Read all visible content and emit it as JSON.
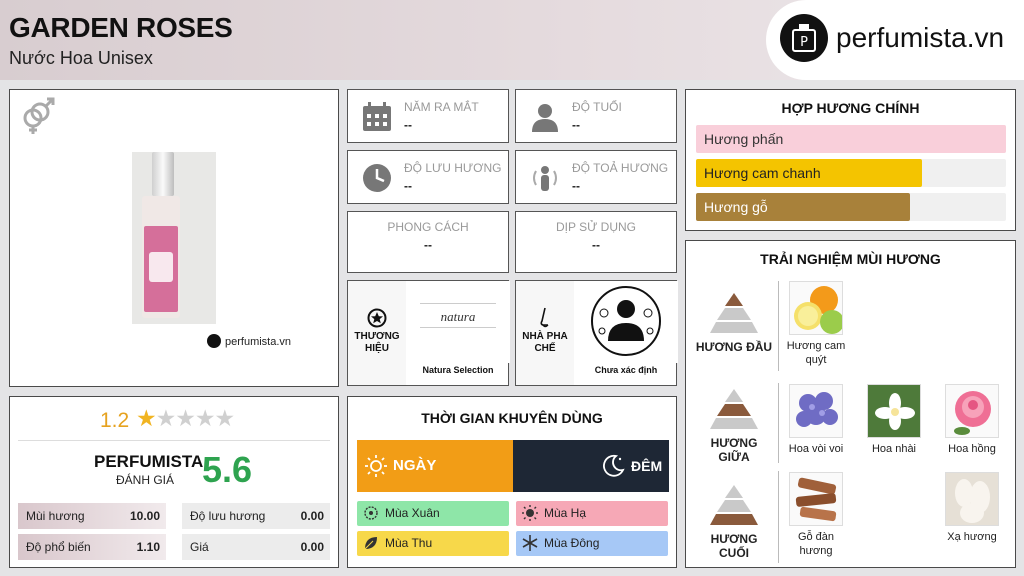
{
  "header": {
    "title": "GARDEN ROSES",
    "subtitle": "Nước Hoa Unisex",
    "logo_text": "perfumista.vn"
  },
  "product": {
    "watermark": "perfumista.vn",
    "gender_icon": "unisex-gender-icon"
  },
  "rating": {
    "score": "1.2",
    "stars_filled": 1.2,
    "stars_total": 5,
    "perfumista_label": "PERFUMISTA",
    "perfumista_sub": "ĐÁNH GIÁ",
    "perfumista_score": "5.6",
    "metrics": [
      {
        "label": "Mùi hương",
        "value": "10.00"
      },
      {
        "label": "Độ lưu hương",
        "value": "0.00"
      },
      {
        "label": "Độ phổ biến",
        "value": "1.10"
      },
      {
        "label": "Giá",
        "value": "0.00"
      }
    ]
  },
  "info": {
    "release": {
      "label": "NĂM RA MẮT",
      "value": "--"
    },
    "age": {
      "label": "ĐỘ TUỔI",
      "value": "--"
    },
    "longevity": {
      "label": "ĐỘ LƯU HƯƠNG",
      "value": "--"
    },
    "sillage": {
      "label": "ĐỘ TOẢ HƯƠNG",
      "value": "--"
    },
    "style": {
      "label": "PHONG CÁCH",
      "value": "--"
    },
    "occasion": {
      "label": "DỊP SỬ DỤNG",
      "value": "--"
    }
  },
  "brand": {
    "label": "THƯƠNG HIỆU",
    "name": "Natura Selection",
    "logo_text": "natura"
  },
  "perfumer": {
    "label": "NHÀ PHA CHẾ",
    "name": "Chưa xác định"
  },
  "time": {
    "title": "THỜI GIAN KHUYÊN DÙNG",
    "day": "NGÀY",
    "night": "ĐÊM",
    "seasons": [
      {
        "label": "Mùa Xuân",
        "color": "#8ee6a8"
      },
      {
        "label": "Mùa Hạ",
        "color": "#f6a8b6"
      },
      {
        "label": "Mùa Thu",
        "color": "#f7d84a"
      },
      {
        "label": "Mùa Đông",
        "color": "#a6c8f6"
      }
    ]
  },
  "accords": {
    "title": "HỢP HƯƠNG CHÍNH",
    "items": [
      {
        "label": "Hương phấn",
        "level": 1.0,
        "color": "#f9cfda",
        "text_color": "#333333"
      },
      {
        "label": "Hương cam chanh",
        "level": 0.73,
        "color": "#f4c400",
        "text_color": "#222222"
      },
      {
        "label": "Hương gỗ",
        "level": 0.69,
        "color": "#a8813a",
        "text_color": "#ffffff"
      }
    ]
  },
  "notes": {
    "title": "TRẢI NGHIỆM MÙI HƯƠNG",
    "top_label": "HƯƠNG ĐẦU",
    "middle_label": "HƯƠNG GIỮA",
    "base_label": "HƯƠNG CUỐI",
    "top": [
      {
        "label": "Hương cam quýt"
      }
    ],
    "middle": [
      {
        "label": "Hoa vòi voi"
      },
      {
        "label": "Hoa nhài"
      },
      {
        "label": "Hoa hồng"
      }
    ],
    "base": [
      {
        "label": "Gỗ đàn hương"
      },
      {
        "label": "Xạ hương"
      }
    ]
  }
}
